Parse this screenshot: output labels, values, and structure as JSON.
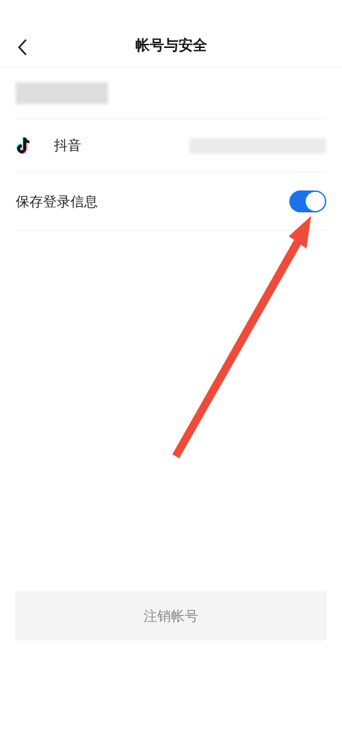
{
  "header": {
    "title": "帐号与安全"
  },
  "rows": [
    {
      "kind": "blurred"
    },
    {
      "kind": "linked",
      "label": "抖音"
    },
    {
      "kind": "toggle",
      "label": "保存登录信息",
      "on": true
    }
  ],
  "button": {
    "label": "注销帐号"
  }
}
